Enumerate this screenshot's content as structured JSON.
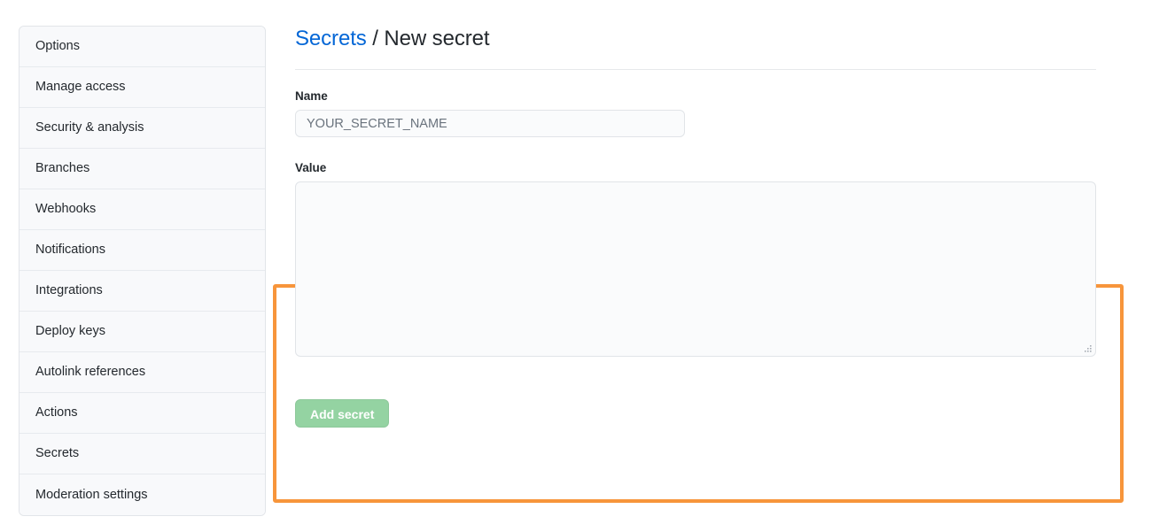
{
  "sidebar": {
    "items": [
      {
        "label": "Options",
        "name": "sidebar-item-options"
      },
      {
        "label": "Manage access",
        "name": "sidebar-item-manage-access"
      },
      {
        "label": "Security & analysis",
        "name": "sidebar-item-security-analysis"
      },
      {
        "label": "Branches",
        "name": "sidebar-item-branches"
      },
      {
        "label": "Webhooks",
        "name": "sidebar-item-webhooks"
      },
      {
        "label": "Notifications",
        "name": "sidebar-item-notifications"
      },
      {
        "label": "Integrations",
        "name": "sidebar-item-integrations"
      },
      {
        "label": "Deploy keys",
        "name": "sidebar-item-deploy-keys"
      },
      {
        "label": "Autolink references",
        "name": "sidebar-item-autolink-references"
      },
      {
        "label": "Actions",
        "name": "sidebar-item-actions"
      },
      {
        "label": "Secrets",
        "name": "sidebar-item-secrets"
      },
      {
        "label": "Moderation settings",
        "name": "sidebar-item-moderation-settings"
      }
    ]
  },
  "header": {
    "breadcrumb_link": "Secrets",
    "breadcrumb_separator": " / ",
    "breadcrumb_current": "New secret"
  },
  "form": {
    "name_label": "Name",
    "name_value": "",
    "name_placeholder": "YOUR_SECRET_NAME",
    "value_label": "Value",
    "value_value": "",
    "value_placeholder": "",
    "submit_label": "Add secret"
  },
  "colors": {
    "link_blue": "#0366d6",
    "highlight_orange": "#f7953b",
    "button_green_disabled": "#94d3a2",
    "sidebar_background": "#f8f9fb",
    "input_background": "#fafbfc",
    "border_gray": "#e1e4e8",
    "text_primary": "#24292e",
    "placeholder_gray": "#6a737d"
  },
  "icons": {
    "resize_grip": "resize-grip-icon"
  }
}
